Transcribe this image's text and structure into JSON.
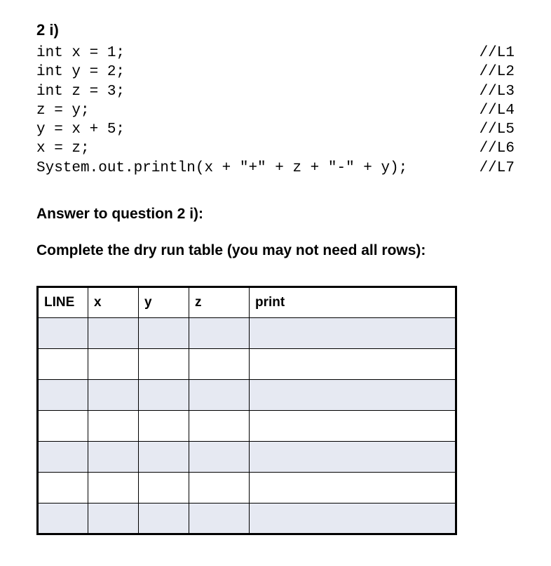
{
  "question_label": "2 i)",
  "code_lines": [
    {
      "text": "int x = 1;",
      "comment": "//L1"
    },
    {
      "text": "int y = 2;",
      "comment": "//L2"
    },
    {
      "text": "int z = 3;",
      "comment": "//L3"
    },
    {
      "text": "z = y;",
      "comment": "//L4"
    },
    {
      "text": "y = x + 5;",
      "comment": "//L5"
    },
    {
      "text": "x = z;",
      "comment": "//L6"
    },
    {
      "text": "System.out.println(x + \"+\" + z + \"-\" + y);",
      "comment": "//L7"
    }
  ],
  "answer_heading": "Answer to question 2 i):",
  "instruction": "Complete the dry run table (you may not need all rows):",
  "table": {
    "headers": [
      "LINE",
      "x",
      "y",
      "z",
      "print"
    ],
    "rows": [
      {
        "line": "",
        "x": "",
        "y": "",
        "z": "",
        "print": ""
      },
      {
        "line": "",
        "x": "",
        "y": "",
        "z": "",
        "print": ""
      },
      {
        "line": "",
        "x": "",
        "y": "",
        "z": "",
        "print": ""
      },
      {
        "line": "",
        "x": "",
        "y": "",
        "z": "",
        "print": ""
      },
      {
        "line": "",
        "x": "",
        "y": "",
        "z": "",
        "print": ""
      },
      {
        "line": "",
        "x": "",
        "y": "",
        "z": "",
        "print": ""
      },
      {
        "line": "",
        "x": "",
        "y": "",
        "z": "",
        "print": ""
      }
    ]
  }
}
